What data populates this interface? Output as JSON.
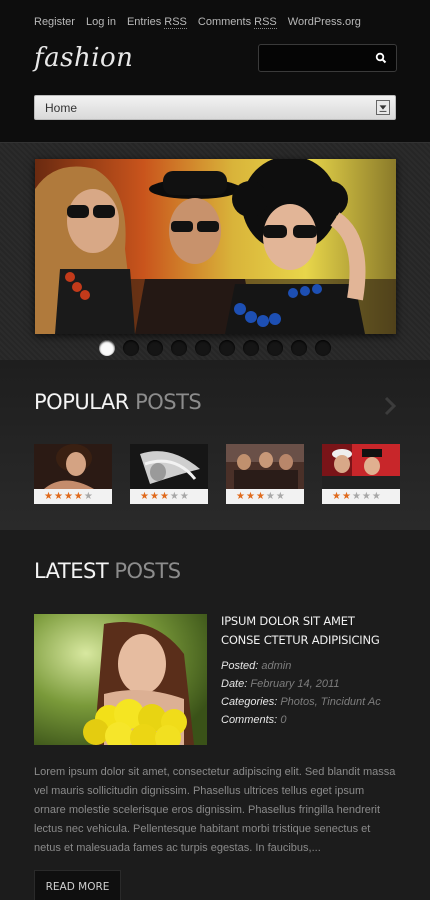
{
  "topnav": {
    "register": "Register",
    "login": "Log in",
    "entries": "Entries",
    "entries_rss": "RSS",
    "comments": "Comments",
    "comments_rss": "RSS",
    "wordpress": "WordPress.org"
  },
  "logo": {
    "text": "fashion"
  },
  "search": {
    "value": "",
    "placeholder": ""
  },
  "menu_select": {
    "selected": "Home"
  },
  "slider": {
    "slide_count": 10,
    "active_index": 0
  },
  "popular": {
    "title_bold": "POPULAR",
    "title_light": "POSTS",
    "items": [
      {
        "image": "woman-portrait-photo",
        "rating": 4
      },
      {
        "image": "blonde-hair-bw-photo",
        "rating": 3
      },
      {
        "image": "group-street-photo",
        "rating": 3
      },
      {
        "image": "models-colorful-photo",
        "rating": 2
      }
    ],
    "max_rating": 5
  },
  "latest": {
    "title_bold": "LATEST",
    "title_light": "POSTS",
    "post": {
      "title": "IPSUM DOLOR SIT AMET CONSE CTETUR ADIPISICING",
      "posted_label": "Posted:",
      "posted_value": "admin",
      "date_label": "Date:",
      "date_value": "February 14, 2011",
      "categories_label": "Categories:",
      "categories_value": "Photos, Tincidunt Ac",
      "comments_label": "Comments:",
      "comments_value": "0",
      "excerpt": "Lorem ipsum dolor sit amet, consectetur adipiscing elit. Sed blandit massa vel mauris sollicitudin dignissim. Phasellus ultrices tellus eget ipsum ornare molestie scelerisque eros dignissim. Phasellus fringilla hendrerit lectus nec vehicula. Pellentesque habitant morbi tristique senectus et netus et malesuada fames ac turpis egestas. In faucibus,...",
      "read_more": "READ MORE"
    }
  },
  "colors": {
    "accent_star": "#e06a1c",
    "background": "#1c1c1c",
    "header": "#0d0d0d"
  }
}
